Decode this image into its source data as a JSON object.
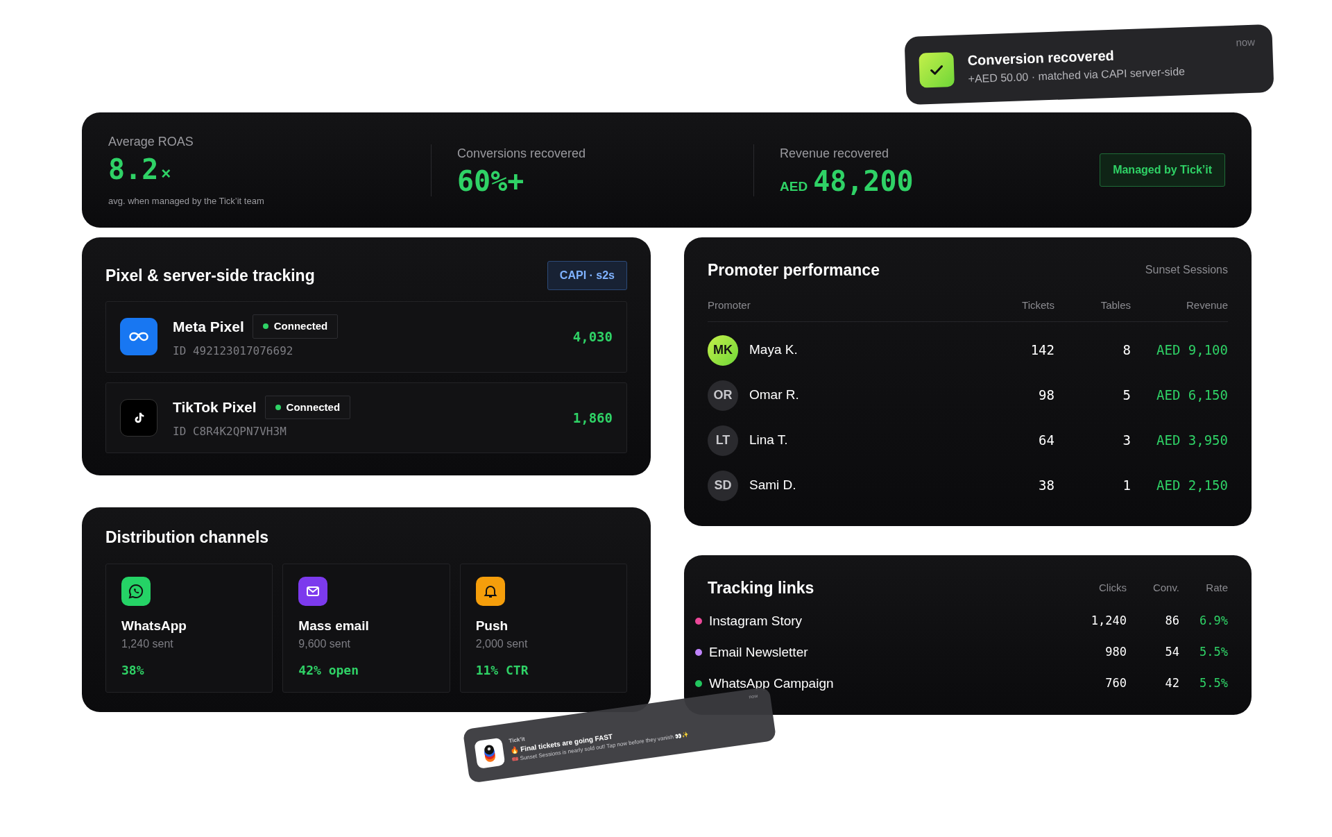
{
  "toast": {
    "title": "Conversion recovered",
    "subtitle": "+AED 50.00 · matched via CAPI server-side",
    "time": "now"
  },
  "stats": {
    "items": [
      {
        "label": "Average ROAS",
        "value": "8.2",
        "suffix": "×",
        "note": "avg. when managed by the Tick’it team"
      },
      {
        "label": "Conversions recovered",
        "value": "60%+"
      },
      {
        "label": "Revenue recovered",
        "value": "48,200",
        "prefix": "AED"
      }
    ],
    "badge": "Managed by Tick’it"
  },
  "pixel_tracking": {
    "title": "Pixel & server-side tracking",
    "badge": "CAPI · s2s",
    "pixels": [
      {
        "kind": "meta",
        "name": "Meta Pixel",
        "status": "Connected",
        "id": "ID 492123017076692",
        "count": "4,030"
      },
      {
        "kind": "tiktok",
        "name": "TikTok Pixel",
        "status": "Connected",
        "id": "ID C8R4K2QPN7VH3M",
        "count": "1,860"
      }
    ]
  },
  "promoters": {
    "title": "Promoter performance",
    "event": "Sunset Sessions",
    "columns": [
      "Promoter",
      "Tickets",
      "Tables",
      "Revenue"
    ],
    "rows": [
      {
        "initials": "MK",
        "name": "Maya K.",
        "tickets": "142",
        "tables": "8",
        "revenue": "AED 9,100",
        "highlighted": true
      },
      {
        "initials": "OR",
        "name": "Omar R.",
        "tickets": "98",
        "tables": "5",
        "revenue": "AED 6,150",
        "highlighted": false
      },
      {
        "initials": "LT",
        "name": "Lina T.",
        "tickets": "64",
        "tables": "3",
        "revenue": "AED 3,950",
        "highlighted": false
      },
      {
        "initials": "SD",
        "name": "Sami D.",
        "tickets": "38",
        "tables": "1",
        "revenue": "AED 2,150",
        "highlighted": false
      }
    ]
  },
  "distribution": {
    "title": "Distribution channels",
    "channels": [
      {
        "kind": "whatsapp",
        "name": "WhatsApp",
        "sent": "1,240 sent",
        "rate": "38%"
      },
      {
        "kind": "email",
        "name": "Mass email",
        "sent": "9,600 sent",
        "rate": "42% open"
      },
      {
        "kind": "push",
        "name": "Push",
        "sent": "2,000 sent",
        "rate": "11% CTR"
      }
    ]
  },
  "tracking_links": {
    "title": "Tracking links",
    "columns": [
      "Clicks",
      "Conv.",
      "Rate"
    ],
    "rows": [
      {
        "name": "Instagram Story",
        "color": "#ec4899",
        "clicks": "1,240",
        "conv": "86",
        "rate": "6.9%"
      },
      {
        "name": "Email Newsletter",
        "color": "#c084fc",
        "clicks": "980",
        "conv": "54",
        "rate": "5.5%"
      },
      {
        "name": "WhatsApp Campaign",
        "color": "#22c55e",
        "clicks": "760",
        "conv": "42",
        "rate": "5.5%"
      }
    ]
  },
  "notification": {
    "app": "Tick’it",
    "title": "🔥 Final tickets are going FAST",
    "body": "🎟️ Sunset Sessions is nearly sold out! Tap now before they vanish 👀✨",
    "time": "now"
  }
}
